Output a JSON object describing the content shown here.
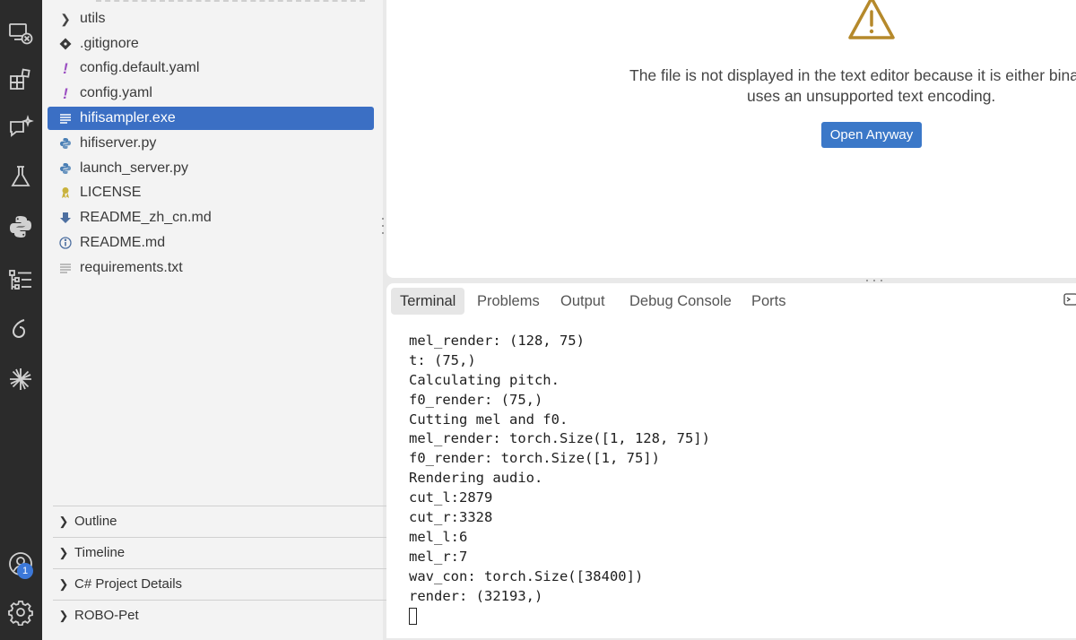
{
  "activity_bar": {
    "icons": [
      "remote-explorer-icon",
      "extensions-icon",
      "chat-icon",
      "testing-icon",
      "python-icon",
      "outline-tree-icon",
      "copilot-icon",
      "sparkle-icon",
      "account-icon",
      "settings-gear-icon"
    ],
    "account_badge": "1"
  },
  "explorer": {
    "items": [
      {
        "label": "utils",
        "icon": "chevron-right-icon"
      },
      {
        "label": ".gitignore",
        "icon": "git-diamond-icon"
      },
      {
        "label": "config.default.yaml",
        "icon": "exclamation-icon"
      },
      {
        "label": "config.yaml",
        "icon": "exclamation-icon"
      },
      {
        "label": "hifisampler.exe",
        "icon": "text-lines-icon"
      },
      {
        "label": "hifiserver.py",
        "icon": "python-file-icon"
      },
      {
        "label": "launch_server.py",
        "icon": "python-file-icon"
      },
      {
        "label": "LICENSE",
        "icon": "license-ribbon-icon"
      },
      {
        "label": "README_zh_cn.md",
        "icon": "download-arrow-icon"
      },
      {
        "label": "README.md",
        "icon": "info-icon"
      },
      {
        "label": "requirements.txt",
        "icon": "text-lines-icon"
      }
    ],
    "selected_index": 4
  },
  "sections": [
    {
      "label": "Outline"
    },
    {
      "label": "Timeline"
    },
    {
      "label": "C# Project Details"
    },
    {
      "label": "ROBO-Pet"
    }
  ],
  "editor": {
    "warning_line1": "The file is not displayed in the text editor because it is either bina",
    "warning_line2": "uses an unsupported text encoding.",
    "open_anyway_label": "Open Anyway"
  },
  "panel": {
    "tabs": [
      "Terminal",
      "Problems",
      "Output",
      "Debug Console",
      "Ports"
    ],
    "active_tab": "Terminal",
    "terminal_lines": [
      "mel_render: (128, 75)",
      "t: (75,)",
      "Calculating pitch.",
      "f0_render: (75,)",
      "Cutting mel and f0.",
      "mel_render: torch.Size([1, 128, 75])",
      "f0_render: torch.Size([1, 75])",
      "Rendering audio.",
      "cut_l:2879",
      "cut_r:3328",
      "mel_l:6",
      "mel_r:7",
      "wav_con: torch.Size([38400])",
      "render: (32193,)"
    ]
  },
  "colors": {
    "activity_bar_bg": "#2b2b2b",
    "sidebar_bg": "#f3f3f3",
    "selection": "#3b6fc4",
    "button": "#3b78c8",
    "warning": "#b5892b",
    "yaml_icon": "#9b4fc2",
    "python_icon": "#4a7fb5"
  }
}
